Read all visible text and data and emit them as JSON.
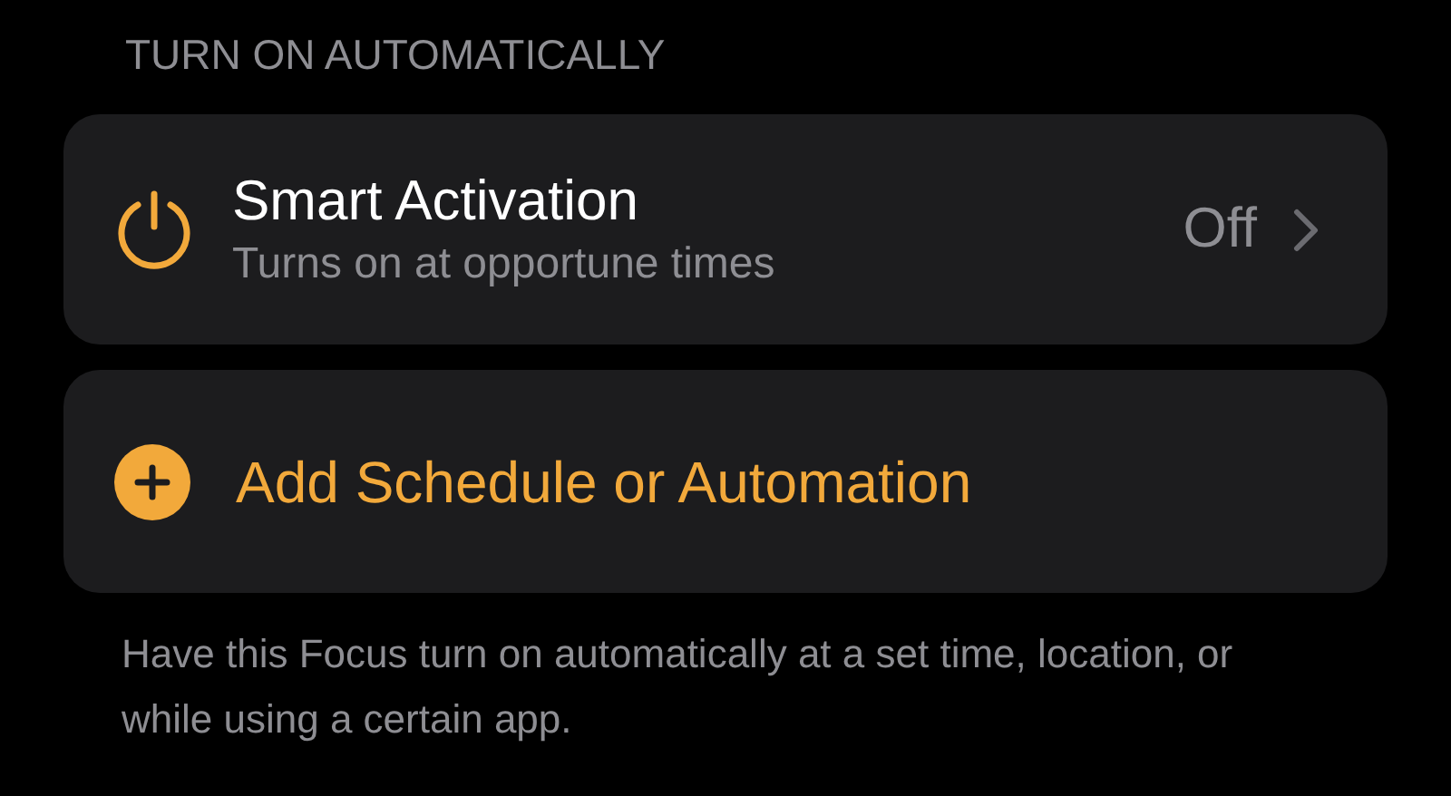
{
  "section_header": "TURN ON AUTOMATICALLY",
  "smart_activation": {
    "title": "Smart Activation",
    "subtitle": "Turns on at opportune times",
    "value": "Off"
  },
  "add_button": {
    "label": "Add Schedule or Automation"
  },
  "footer": "Have this Focus turn on automatically at a set time, location, or while using a certain app."
}
